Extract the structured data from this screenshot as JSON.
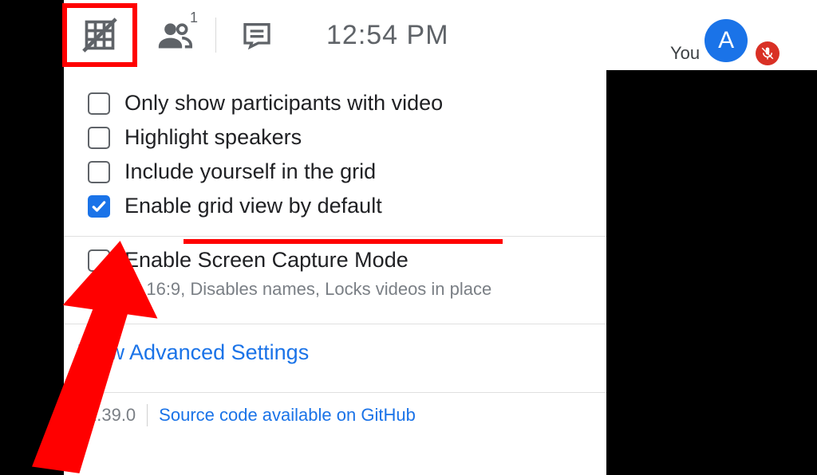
{
  "header": {
    "time": "12:54 PM",
    "you_label": "You",
    "avatar_letter": "A",
    "participant_count": "1"
  },
  "options": [
    {
      "label": "Only show participants with video",
      "checked": false
    },
    {
      "label": "Highlight speakers",
      "checked": false
    },
    {
      "label": "Include yourself in the grid",
      "checked": false
    },
    {
      "label": "Enable grid view by default",
      "checked": true
    }
  ],
  "screen_capture": {
    "label": "Enable Screen Capture Mode",
    "desc": "Forces 16:9, Disables names, Locks videos in place",
    "checked": false
  },
  "advanced_link": "View Advanced Settings",
  "footer": {
    "version": "v1.39.0",
    "github_link": "Source code available on GitHub"
  },
  "colors": {
    "accent": "#1a73e8",
    "annotation": "#f00",
    "mute": "#d93025"
  }
}
